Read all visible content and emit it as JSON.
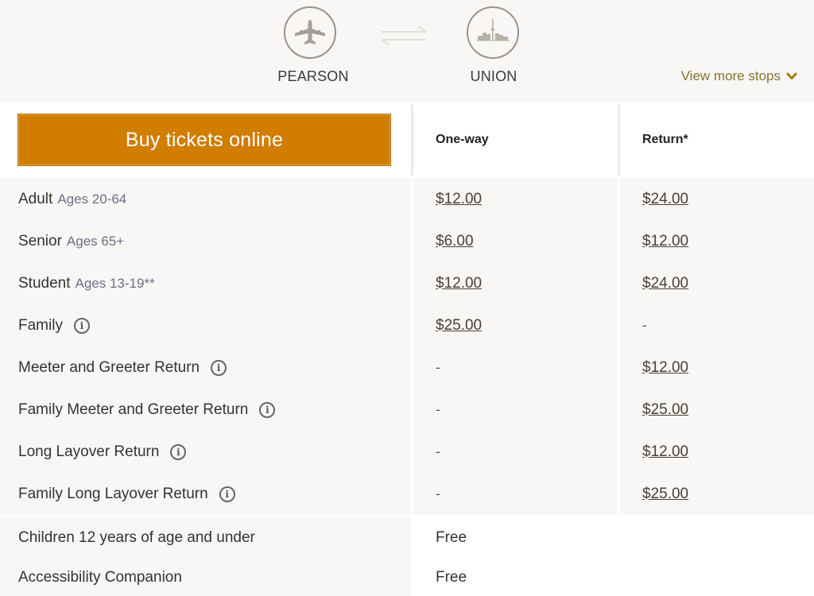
{
  "route": {
    "origin": {
      "label": "PEARSON",
      "icon": "airplane-icon"
    },
    "destination": {
      "label": "UNION",
      "icon": "city-skyline-icon"
    },
    "swap_icon": "swap-arrows-icon",
    "view_more_label": "View more stops",
    "view_more_icon": "chevron-down-icon"
  },
  "table": {
    "buy_button_label": "Buy tickets online",
    "col_one_way": "One-way",
    "col_return": "Return*",
    "rows": [
      {
        "name": "Adult",
        "note": "Ages 20-64",
        "one_way": "$12.00",
        "return": "$24.00"
      },
      {
        "name": "Senior",
        "note": "Ages 65+",
        "one_way": "$6.00",
        "return": "$12.00"
      },
      {
        "name": "Student",
        "note": "Ages 13-19**",
        "one_way": "$12.00",
        "return": "$24.00"
      },
      {
        "name": "Family",
        "info": true,
        "one_way": "$25.00",
        "return": "-"
      },
      {
        "name": "Meeter and Greeter Return",
        "info": true,
        "one_way": "-",
        "return": "$12.00"
      },
      {
        "name": "Family Meeter and Greeter Return",
        "info": true,
        "one_way": "-",
        "return": "$25.00"
      },
      {
        "name": "Long Layover Return",
        "info": true,
        "one_way": "-",
        "return": "$12.00"
      },
      {
        "name": "Family Long Layover Return",
        "info": true,
        "one_way": "-",
        "return": "$25.00"
      },
      {
        "name": "Children 12 years of age and under",
        "one_way": "Free"
      },
      {
        "name": "Accessibility Companion",
        "one_way": "Free"
      }
    ]
  },
  "colors": {
    "accent": "#d07d00",
    "link": "#8a7230",
    "row_bg": "#f8f7f5"
  }
}
